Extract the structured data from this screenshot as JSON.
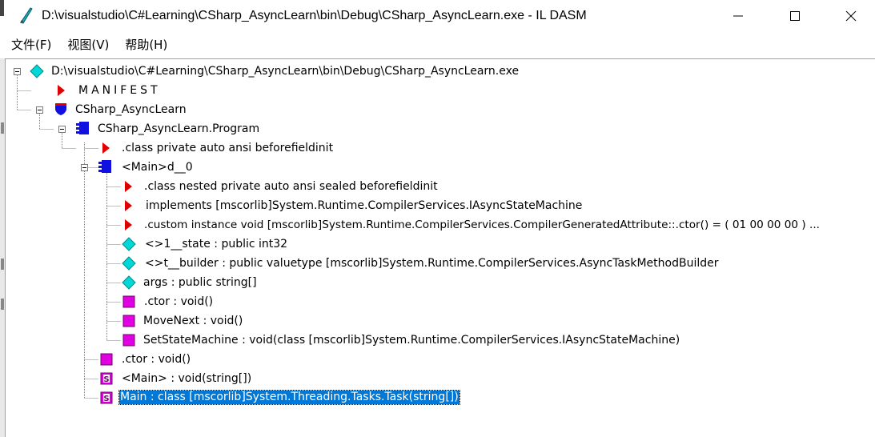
{
  "window": {
    "title": "D:\\visualstudio\\C#Learning\\CSharp_AsyncLearn\\bin\\Debug\\CSharp_AsyncLearn.exe - IL DASM",
    "minimize_icon": "minimize-icon",
    "maximize_icon": "maximize-icon",
    "close_icon": "close-icon"
  },
  "menu": [
    {
      "label": "文件(F)"
    },
    {
      "label": "视图(V)"
    },
    {
      "label": "帮助(H)"
    }
  ],
  "tree": {
    "root": {
      "label": "D:\\visualstudio\\C#Learning\\CSharp_AsyncLearn\\bin\\Debug\\CSharp_AsyncLearn.exe",
      "icon": "diamond-cyan-icon"
    },
    "manifest": {
      "label": "MANIFEST",
      "icon": "triangle-red-icon"
    },
    "namespace": {
      "label": "CSharp_AsyncLearn",
      "icon": "shield-namespace-icon"
    },
    "class_program": {
      "label": "CSharp_AsyncLearn.Program",
      "icon": "class-icon"
    },
    "program_class_decl": {
      "label": ".class private auto ansi beforefieldinit",
      "icon": "triangle-red-icon"
    },
    "class_main_d0": {
      "label": "<Main>d__0",
      "icon": "class-icon"
    },
    "d0_class_decl": {
      "label": ".class nested private auto ansi sealed beforefieldinit",
      "icon": "triangle-red-icon"
    },
    "d0_implements": {
      "label": "implements [mscorlib]System.Runtime.CompilerServices.IAsyncStateMachine",
      "icon": "triangle-red-icon"
    },
    "d0_custom": {
      "label": ".custom instance void [mscorlib]System.Runtime.CompilerServices.CompilerGeneratedAttribute::.ctor() = ( 01 00 00 00 ) ...",
      "icon": "triangle-red-icon"
    },
    "d0_state": {
      "label": "<>1__state : public int32",
      "icon": "diamond-cyan-icon"
    },
    "d0_builder": {
      "label": "<>t__builder : public valuetype [mscorlib]System.Runtime.CompilerServices.AsyncTaskMethodBuilder",
      "icon": "diamond-cyan-icon"
    },
    "d0_args": {
      "label": "args : public string[]",
      "icon": "diamond-cyan-icon"
    },
    "d0_ctor": {
      "label": ".ctor : void()",
      "icon": "method-magenta-icon"
    },
    "d0_movenext": {
      "label": "MoveNext : void()",
      "icon": "method-magenta-icon"
    },
    "d0_setstate": {
      "label": "SetStateMachine : void(class [mscorlib]System.Runtime.CompilerServices.IAsyncStateMachine)",
      "icon": "method-magenta-icon"
    },
    "program_ctor": {
      "label": ".ctor : void()",
      "icon": "method-magenta-icon"
    },
    "program_main_lt": {
      "label": "<Main> : void(string[])",
      "icon": "static-method-icon"
    },
    "program_main": {
      "label": "Main : class [mscorlib]System.Threading.Tasks.Task(string[])",
      "icon": "static-method-icon"
    }
  },
  "colors": {
    "selection": "#0078d7",
    "diamond": "#00d8d8",
    "triangle": "#e00000",
    "class": "#1010e0",
    "method": "#e000e0"
  }
}
